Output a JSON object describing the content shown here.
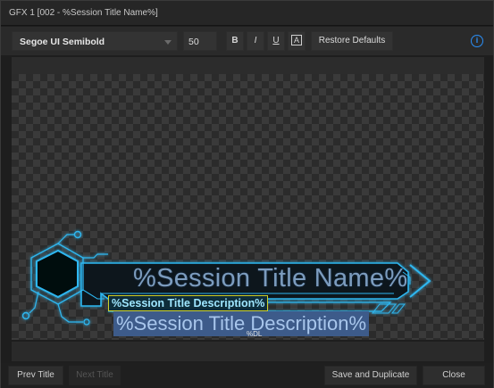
{
  "window": {
    "title": "GFX 1  [002 - %Session Title Name%]"
  },
  "toolbar": {
    "font_name": "Segoe UI Semibold",
    "font_size": "50",
    "bold_label": "B",
    "italic_label": "I",
    "underline_label": "U",
    "outline_label": "A",
    "restore_label": "Restore Defaults",
    "info_label": "i"
  },
  "canvas": {
    "title_text": "%Session Title Name%",
    "description_edit": "%Session Title Description%",
    "description_preview": "%Session Title Description%",
    "cursor_label": "%DL"
  },
  "footer": {
    "prev_label": "Prev Title",
    "next_label": "Next Title",
    "save_label": "Save and Duplicate",
    "close_label": "Close"
  },
  "colors": {
    "accent_blue": "#2a8ff7",
    "frame_cyan": "#2fb7f0",
    "edit_border": "#cfd12a"
  }
}
